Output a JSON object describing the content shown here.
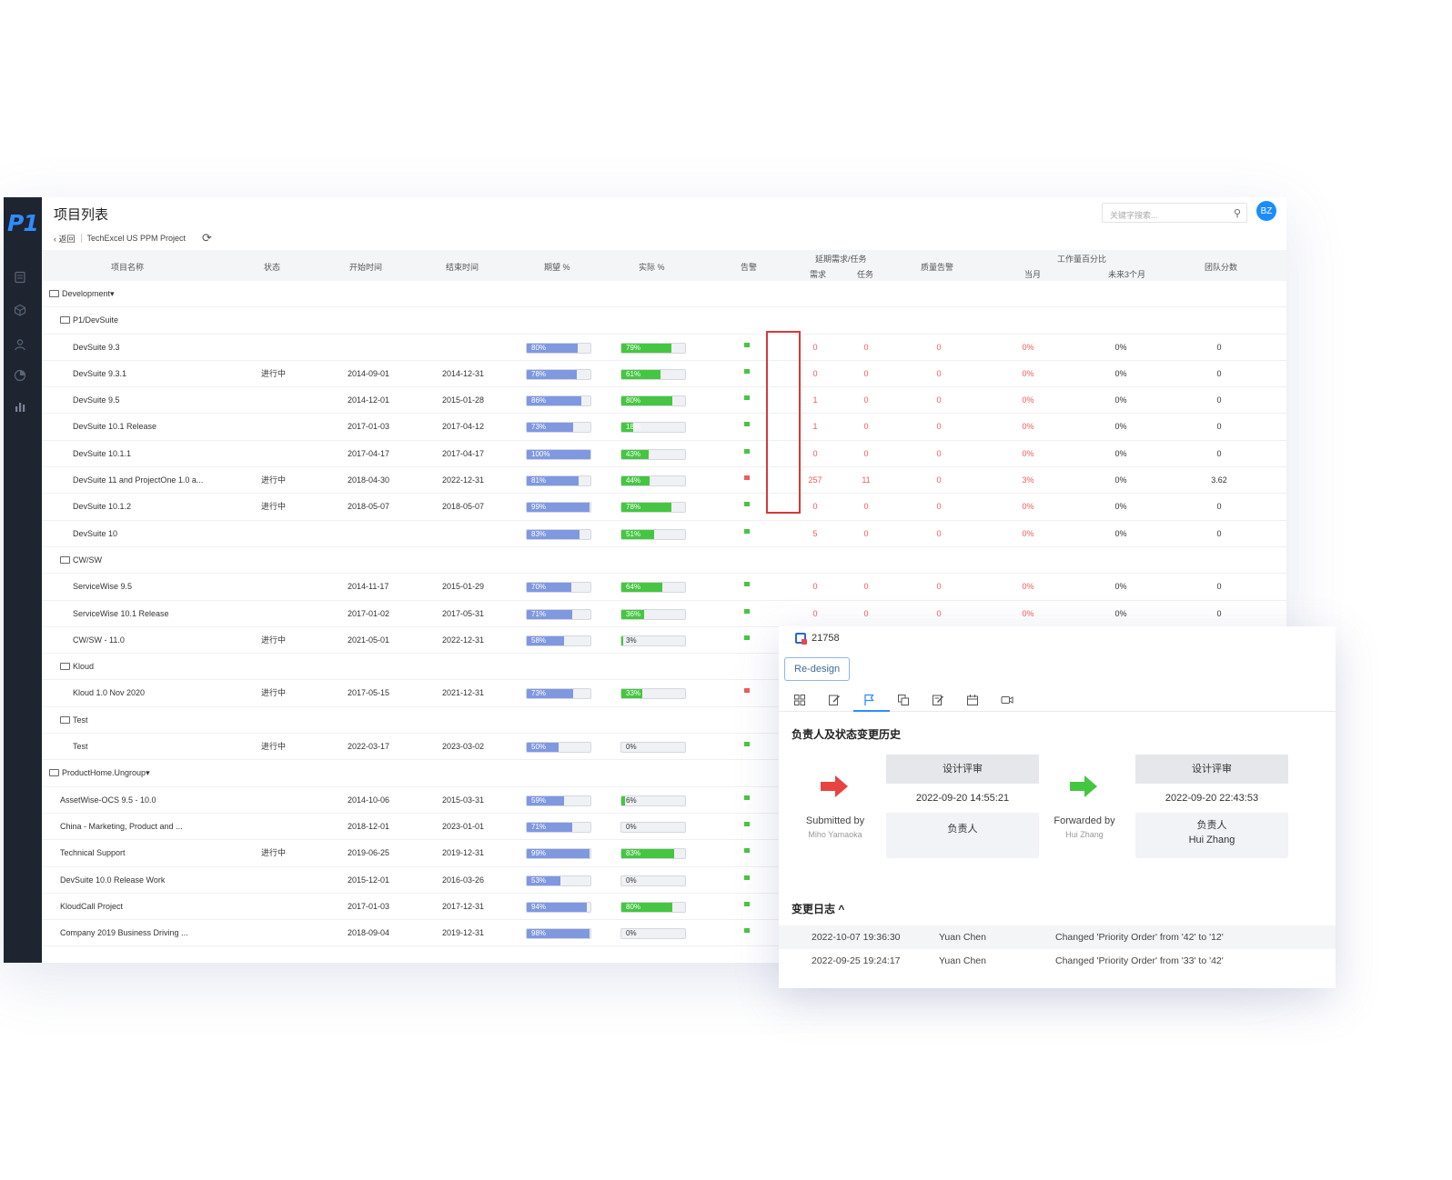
{
  "app": {
    "logo": "P1",
    "page_title": "项目列表",
    "back_label": "‹ 返回",
    "project_name": "TechExcel US PPM Project",
    "search_placeholder": "关键字搜索...",
    "avatar_initials": "BZ"
  },
  "colors": {
    "sidebar": "#1e2430",
    "accent": "#2f8cff",
    "expected_bar": "#7f98e0",
    "actual_bar": "#45c640",
    "alert_red": "#ef5b5b"
  },
  "columns": {
    "name": "项目名称",
    "status": "状态",
    "start": "开始时间",
    "end": "结束时间",
    "expected": "期望 %",
    "actual": "实际 %",
    "alert": "告警",
    "delay_group": "延期需求/任务",
    "delay_req": "需求",
    "delay_task": "任务",
    "quality": "质量告警",
    "workload_group": "工作量百分比",
    "month": "当月",
    "next3": "未来3个月",
    "score": "团队分数"
  },
  "rows": [
    {
      "type": "group",
      "level": 0,
      "name": "Development",
      "caret": "▾"
    },
    {
      "type": "group",
      "level": 1,
      "name": "P1/DevSuite",
      "caret": ""
    },
    {
      "type": "item",
      "level": 2,
      "name": "DevSuite 9.3",
      "status": "",
      "start": "",
      "end": "",
      "expected": "80%",
      "expected_val": 80,
      "actual": "79%",
      "actual_val": 79,
      "alert": "green",
      "req": "0",
      "task": "0",
      "quality": "0",
      "month": "0%",
      "next3": "0%",
      "score": "0"
    },
    {
      "type": "item",
      "level": 2,
      "name": "DevSuite 9.3.1",
      "status": "进行中",
      "start": "2014-09-01",
      "end": "2014-12-31",
      "expected": "78%",
      "expected_val": 78,
      "actual": "61%",
      "actual_val": 61,
      "alert": "green",
      "req": "0",
      "task": "0",
      "quality": "0",
      "month": "0%",
      "next3": "0%",
      "score": "0"
    },
    {
      "type": "item",
      "level": 2,
      "name": "DevSuite 9.5",
      "status": "",
      "start": "2014-12-01",
      "end": "2015-01-28",
      "expected": "86%",
      "expected_val": 86,
      "actual": "80%",
      "actual_val": 80,
      "alert": "green",
      "req": "1",
      "task": "0",
      "quality": "0",
      "month": "0%",
      "next3": "0%",
      "score": "0"
    },
    {
      "type": "item",
      "level": 2,
      "name": "DevSuite 10.1 Release",
      "status": "",
      "start": "2017-01-03",
      "end": "2017-04-12",
      "expected": "73%",
      "expected_val": 73,
      "actual": "18%",
      "actual_val": 18,
      "alert": "green",
      "req": "1",
      "task": "0",
      "quality": "0",
      "month": "0%",
      "next3": "0%",
      "score": "0"
    },
    {
      "type": "item",
      "level": 2,
      "name": "DevSuite 10.1.1",
      "status": "",
      "start": "2017-04-17",
      "end": "2017-04-17",
      "expected": "100%",
      "expected_val": 100,
      "actual": "43%",
      "actual_val": 43,
      "alert": "green",
      "req": "0",
      "task": "0",
      "quality": "0",
      "month": "0%",
      "next3": "0%",
      "score": "0"
    },
    {
      "type": "item",
      "level": 2,
      "name": "DevSuite 11 and ProjectOne 1.0 a...",
      "status": "进行中",
      "start": "2018-04-30",
      "end": "2022-12-31",
      "expected": "81%",
      "expected_val": 81,
      "actual": "44%",
      "actual_val": 44,
      "alert": "red",
      "req": "257",
      "task": "11",
      "quality": "0",
      "month": "3%",
      "next3": "0%",
      "score": "3.62"
    },
    {
      "type": "item",
      "level": 2,
      "name": "DevSuite 10.1.2",
      "status": "进行中",
      "start": "2018-05-07",
      "end": "2018-05-07",
      "expected": "99%",
      "expected_val": 99,
      "actual": "78%",
      "actual_val": 78,
      "alert": "green",
      "req": "0",
      "task": "0",
      "quality": "0",
      "month": "0%",
      "next3": "0%",
      "score": "0"
    },
    {
      "type": "item",
      "level": 2,
      "name": "DevSuite 10",
      "status": "",
      "start": "",
      "end": "",
      "expected": "83%",
      "expected_val": 83,
      "actual": "51%",
      "actual_val": 51,
      "alert": "green",
      "req": "5",
      "task": "0",
      "quality": "0",
      "month": "0%",
      "next3": "0%",
      "score": "0"
    },
    {
      "type": "group",
      "level": 1,
      "name": "CW/SW",
      "caret": ""
    },
    {
      "type": "item",
      "level": 2,
      "name": "ServiceWise 9.5",
      "status": "",
      "start": "2014-11-17",
      "end": "2015-01-29",
      "expected": "70%",
      "expected_val": 70,
      "actual": "64%",
      "actual_val": 64,
      "alert": "green",
      "req": "0",
      "task": "0",
      "quality": "0",
      "month": "0%",
      "next3": "0%",
      "score": "0"
    },
    {
      "type": "item",
      "level": 2,
      "name": "ServiceWise 10.1 Release",
      "status": "",
      "start": "2017-01-02",
      "end": "2017-05-31",
      "expected": "71%",
      "expected_val": 71,
      "actual": "36%",
      "actual_val": 36,
      "alert": "green",
      "req": "0",
      "task": "0",
      "quality": "0",
      "month": "0%",
      "next3": "0%",
      "score": "0"
    },
    {
      "type": "item",
      "level": 2,
      "name": "CW/SW - 11.0",
      "status": "进行中",
      "start": "2021-05-01",
      "end": "2022-12-31",
      "expected": "58%",
      "expected_val": 58,
      "actual": "3%",
      "actual_val": 3,
      "alert": "green",
      "req": "",
      "task": "",
      "quality": "",
      "month": "",
      "next3": "",
      "score": ""
    },
    {
      "type": "group",
      "level": 1,
      "name": "Kloud",
      "caret": ""
    },
    {
      "type": "item",
      "level": 2,
      "name": "Kloud 1.0 Nov 2020",
      "status": "进行中",
      "start": "2017-05-15",
      "end": "2021-12-31",
      "expected": "73%",
      "expected_val": 73,
      "actual": "33%",
      "actual_val": 33,
      "alert": "red",
      "req": "",
      "task": "",
      "quality": "",
      "month": "",
      "next3": "",
      "score": ""
    },
    {
      "type": "group",
      "level": 1,
      "name": "Test",
      "caret": ""
    },
    {
      "type": "item",
      "level": 2,
      "name": "Test",
      "status": "进行中",
      "start": "2022-03-17",
      "end": "2023-03-02",
      "expected": "50%",
      "expected_val": 50,
      "actual": "0%",
      "actual_val": 0,
      "alert": "green",
      "req": "",
      "task": "",
      "quality": "",
      "month": "",
      "next3": "",
      "score": ""
    },
    {
      "type": "group",
      "level": 0,
      "name": "ProductHome.Ungroup",
      "caret": "▾"
    },
    {
      "type": "item",
      "level": 1,
      "name": "AssetWise-OCS 9.5 - 10.0",
      "status": "",
      "start": "2014-10-06",
      "end": "2015-03-31",
      "expected": "59%",
      "expected_val": 59,
      "actual": "6%",
      "actual_val": 6,
      "alert": "green",
      "req": "",
      "task": "",
      "quality": "",
      "month": "",
      "next3": "",
      "score": ""
    },
    {
      "type": "item",
      "level": 1,
      "name": "China - Marketing, Product and ...",
      "status": "",
      "start": "2018-12-01",
      "end": "2023-01-01",
      "expected": "71%",
      "expected_val": 71,
      "actual": "0%",
      "actual_val": 0,
      "alert": "green",
      "req": "",
      "task": "",
      "quality": "",
      "month": "",
      "next3": "",
      "score": ""
    },
    {
      "type": "item",
      "level": 1,
      "name": "Technical Support",
      "status": "进行中",
      "start": "2019-06-25",
      "end": "2019-12-31",
      "expected": "99%",
      "expected_val": 99,
      "actual": "83%",
      "actual_val": 83,
      "alert": "green",
      "req": "",
      "task": "",
      "quality": "",
      "month": "",
      "next3": "",
      "score": ""
    },
    {
      "type": "item",
      "level": 1,
      "name": "DevSuite 10.0 Release Work",
      "status": "",
      "start": "2015-12-01",
      "end": "2016-03-26",
      "expected": "53%",
      "expected_val": 53,
      "actual": "0%",
      "actual_val": 0,
      "alert": "green",
      "req": "",
      "task": "",
      "quality": "",
      "month": "",
      "next3": "",
      "score": ""
    },
    {
      "type": "item",
      "level": 1,
      "name": "KloudCall Project",
      "status": "",
      "start": "2017-01-03",
      "end": "2017-12-31",
      "expected": "94%",
      "expected_val": 94,
      "actual": "80%",
      "actual_val": 80,
      "alert": "green",
      "req": "",
      "task": "",
      "quality": "",
      "month": "",
      "next3": "",
      "score": ""
    },
    {
      "type": "item",
      "level": 1,
      "name": "Company 2019 Business Driving ...",
      "status": "",
      "start": "2018-09-04",
      "end": "2019-12-31",
      "expected": "98%",
      "expected_val": 98,
      "actual": "0%",
      "actual_val": 0,
      "alert": "green",
      "req": "",
      "task": "",
      "quality": "",
      "month": "",
      "next3": "",
      "score": ""
    }
  ],
  "detail": {
    "id": "21758",
    "tag": "Re-design",
    "section_title": "负责人及状态变更历史",
    "steps": [
      {
        "status": "设计评审",
        "time": "2022-09-20 14:55:21",
        "role": "负责人",
        "person": "",
        "action": "Submitted by",
        "actor": "Miho Yamaoka",
        "arrow": "red"
      },
      {
        "status": "设计评审",
        "time": "2022-09-20 22:43:53",
        "role": "负责人",
        "person": "Hui Zhang",
        "action": "Forwarded by",
        "actor": "Hui Zhang",
        "arrow": "green"
      }
    ],
    "log_title": "变更日志 ^",
    "log": [
      {
        "time": "2022-10-07 19:36:30",
        "user": "Yuan Chen",
        "change": "Changed 'Priority Order' from '42' to '12'"
      },
      {
        "time": "2022-09-25 19:24:17",
        "user": "Yuan Chen",
        "change": "Changed 'Priority Order' from '33' to '42'"
      }
    ]
  }
}
